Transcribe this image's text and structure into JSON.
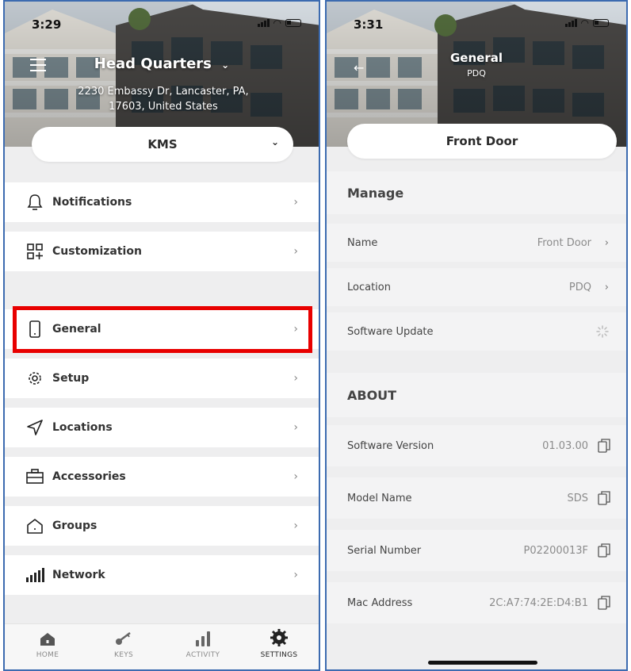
{
  "left_screen": {
    "status_time": "3:29",
    "site_title": "Head Quarters",
    "address_line1": "2230 Embassy Dr, Lancaster, PA,",
    "address_line2": "17603, United States",
    "org_selector": "KMS",
    "menu": [
      {
        "label": "Notifications",
        "icon": "bell-icon"
      },
      {
        "label": "Customization",
        "icon": "customize-grid-icon"
      },
      {
        "label": "General",
        "icon": "phone-icon"
      },
      {
        "label": "Setup",
        "icon": "gear-icon"
      },
      {
        "label": "Locations",
        "icon": "location-arrow-icon"
      },
      {
        "label": "Accessories",
        "icon": "toolbox-icon"
      },
      {
        "label": "Groups",
        "icon": "house-outline-icon"
      },
      {
        "label": "Network",
        "icon": "signal-bars-icon"
      }
    ],
    "tabs": [
      {
        "label": "HOME",
        "icon": "home-icon"
      },
      {
        "label": "KEYS",
        "icon": "key-icon"
      },
      {
        "label": "ACTIVITY",
        "icon": "activity-bars-icon"
      },
      {
        "label": "SETTINGS",
        "icon": "settings-gear-icon"
      }
    ],
    "highlight_color": "#e80000"
  },
  "right_screen": {
    "status_time": "3:31",
    "title": "General",
    "subtitle": "PDQ",
    "device_selector": "Front Door",
    "manage_section": "Manage",
    "manage_rows": [
      {
        "label": "Name",
        "value": "Front Door"
      },
      {
        "label": "Location",
        "value": "PDQ"
      },
      {
        "label": "Software Update",
        "value": ""
      }
    ],
    "about_section": "ABOUT",
    "about_rows": [
      {
        "label": "Software Version",
        "value": "01.03.00"
      },
      {
        "label": "Model Name",
        "value": "SDS"
      },
      {
        "label": "Serial Number",
        "value": "P02200013F"
      },
      {
        "label": "Mac Address",
        "value": "2C:A7:74:2E:D4:B1"
      }
    ]
  }
}
